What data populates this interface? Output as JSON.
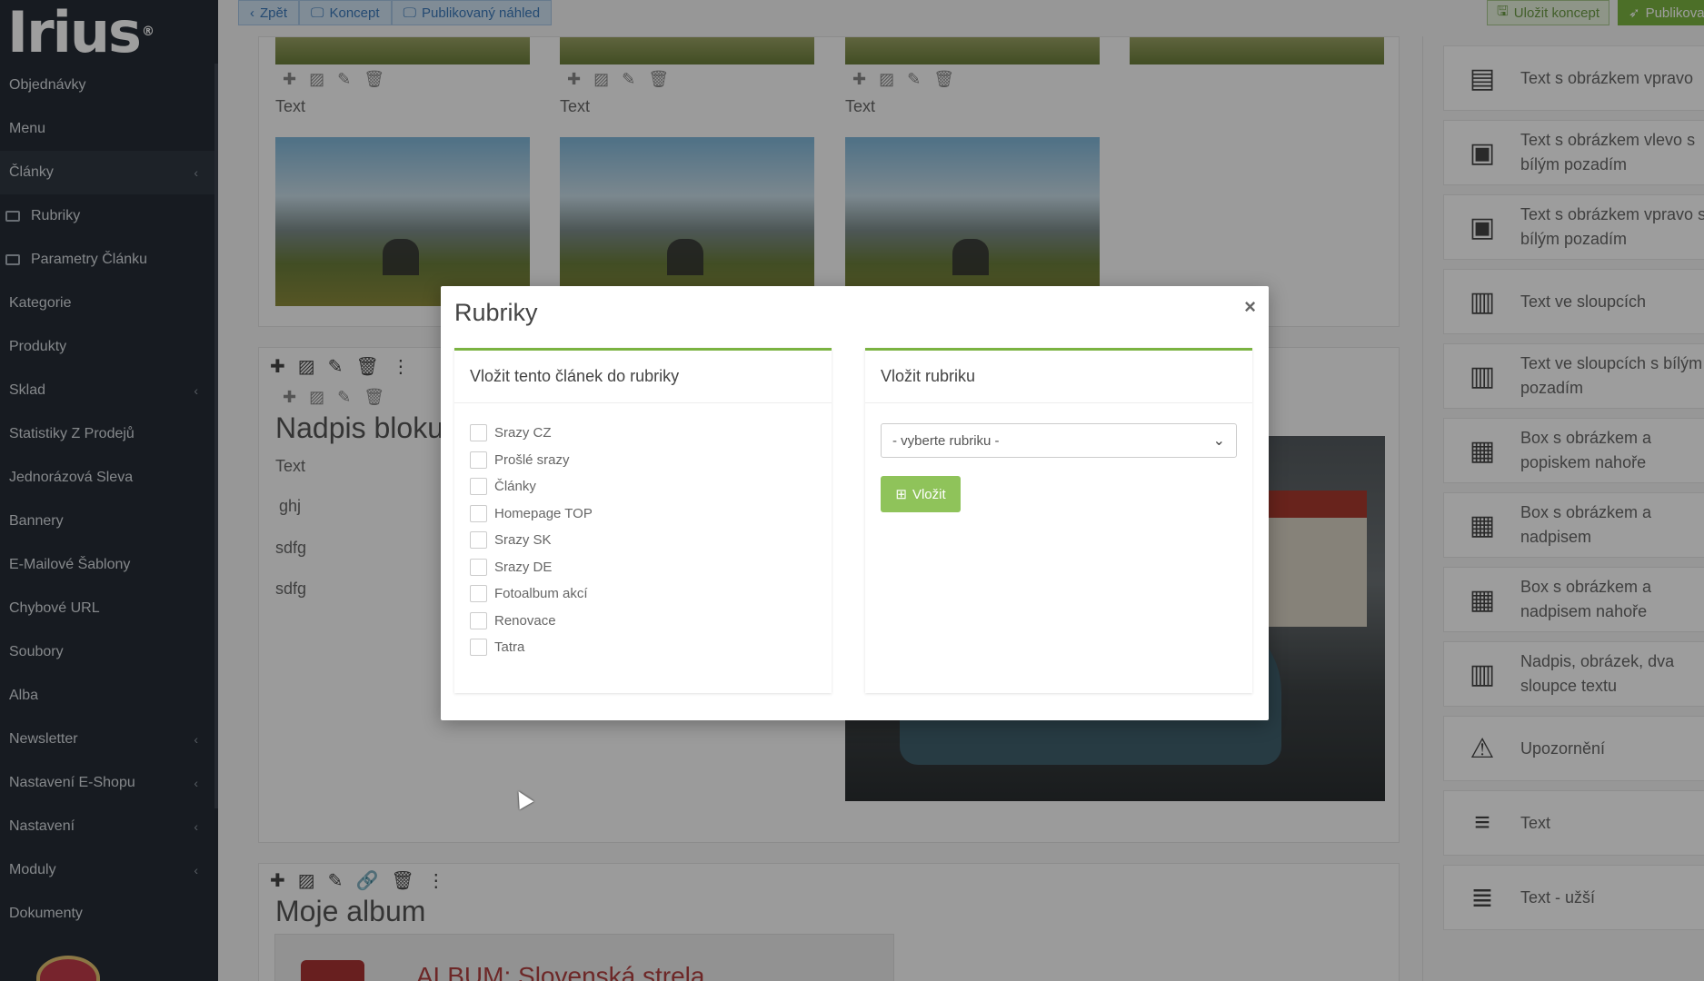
{
  "app": {
    "logo_text": "Irius",
    "logo_sup": "®"
  },
  "sidebar": {
    "items": [
      {
        "label": "Objednávky",
        "chevron": false,
        "sub": false
      },
      {
        "label": "Menu",
        "chevron": false,
        "sub": false
      },
      {
        "label": "Články",
        "chevron": true,
        "sub": false,
        "active": true
      },
      {
        "label": "Rubriky",
        "chevron": false,
        "sub": true,
        "icon": "newspaper-icon"
      },
      {
        "label": "Parametry Článku",
        "chevron": false,
        "sub": true,
        "icon": "sliders-icon"
      },
      {
        "label": "Kategorie",
        "chevron": false,
        "sub": false
      },
      {
        "label": "Produkty",
        "chevron": false,
        "sub": false
      },
      {
        "label": "Sklad",
        "chevron": true,
        "sub": false
      },
      {
        "label": "Statistiky Z Prodejů",
        "chevron": false,
        "sub": false
      },
      {
        "label": "Jednorázová Sleva",
        "chevron": false,
        "sub": false
      },
      {
        "label": "Bannery",
        "chevron": false,
        "sub": false
      },
      {
        "label": "E-Mailové Šablony",
        "chevron": false,
        "sub": false
      },
      {
        "label": "Chybové URL",
        "chevron": false,
        "sub": false
      },
      {
        "label": "Soubory",
        "chevron": false,
        "sub": false
      },
      {
        "label": "Alba",
        "chevron": false,
        "sub": false
      },
      {
        "label": "Newsletter",
        "chevron": true,
        "sub": false
      },
      {
        "label": "Nastavení E-Shopu",
        "chevron": true,
        "sub": false
      },
      {
        "label": "Nastavení",
        "chevron": true,
        "sub": false
      },
      {
        "label": "Moduly",
        "chevron": true,
        "sub": false
      },
      {
        "label": "Dokumenty",
        "chevron": false,
        "sub": false
      }
    ],
    "chevron_glyph": "‹"
  },
  "topbar": {
    "back_label": "Zpět",
    "concept_label": "Koncept",
    "published_preview_label": "Publikovaný náhled",
    "save_concept_label": "Uložit koncept",
    "publish_label": "Publikovat"
  },
  "editor": {
    "text_label": "Text",
    "block_heading": "Nadpis bloku",
    "block_lines": [
      "ghj",
      "sdfg",
      "sdfg"
    ],
    "album_heading": "Moje album",
    "album_card_text": "ALBUM: Slovenská strela"
  },
  "palette": {
    "items": [
      {
        "label": "Text s obrázkem vpravo",
        "icon": "text-image-right-icon",
        "glyph": "▤"
      },
      {
        "label": "Text s obrázkem vlevo s bílým pozadím",
        "icon": "text-image-left-white-icon",
        "glyph": "▣"
      },
      {
        "label": "Text s obrázkem vpravo s bílým pozadím",
        "icon": "text-image-right-white-icon",
        "glyph": "▣"
      },
      {
        "label": "Text ve sloupcích",
        "icon": "text-columns-icon",
        "glyph": "▥"
      },
      {
        "label": "Text ve sloupcích s bílým pozadím",
        "icon": "text-columns-white-icon",
        "glyph": "▥"
      },
      {
        "label": "Box s obrázkem a popiskem nahoře",
        "icon": "box-image-caption-top-icon",
        "glyph": "▦"
      },
      {
        "label": "Box s obrázkem a nadpisem",
        "icon": "box-image-heading-icon",
        "glyph": "▦"
      },
      {
        "label": "Box s obrázkem a nadpisem nahoře",
        "icon": "box-image-heading-top-icon",
        "glyph": "▦"
      },
      {
        "label": "Nadpis, obrázek, dva sloupce textu",
        "icon": "heading-image-two-columns-icon",
        "glyph": "▥"
      },
      {
        "label": "Upozornění",
        "icon": "warning-icon",
        "glyph": "⚠"
      },
      {
        "label": "Text",
        "icon": "align-left-icon",
        "glyph": "≡"
      },
      {
        "label": "Text - užší",
        "icon": "align-narrow-icon",
        "glyph": "≣"
      }
    ]
  },
  "modal": {
    "title": "Rubriky",
    "close_glyph": "×",
    "left_box": {
      "heading": "Vložit tento článek do rubriky",
      "categories": [
        "Srazy CZ",
        "Prošlé srazy",
        "Články",
        "Homepage TOP",
        "Srazy SK",
        "Srazy DE",
        "Fotoalbum akcí",
        "Renovace",
        "Tatra"
      ]
    },
    "right_box": {
      "heading": "Vložit rubriku",
      "select_value": "- vyberte rubriku -",
      "insert_label": "Vložit"
    }
  },
  "colors": {
    "sidebar_bg": "#262d36",
    "accent_green": "#7bb342",
    "button_green": "#8fc35a",
    "top_button_blue": "#3a78b8"
  }
}
